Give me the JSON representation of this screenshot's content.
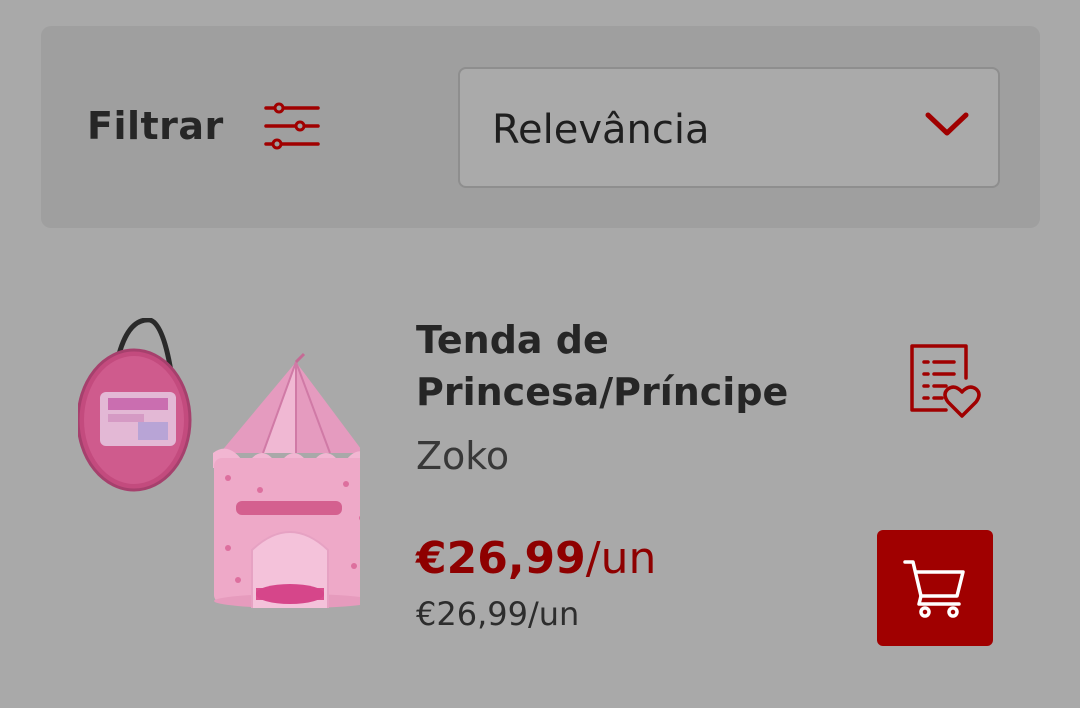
{
  "toolbar": {
    "filter_label": "Filtrar",
    "filter_icon": "sliders-icon",
    "sort": {
      "selected": "Relevância",
      "icon": "chevron-down-icon"
    }
  },
  "products": [
    {
      "title_line1": "Tenda de",
      "title_line2": "Princesa/Príncipe",
      "brand": "Zoko",
      "price_value": "€26,99",
      "price_unit": "/un",
      "price_secondary": "€26,99/un",
      "image_icon": "princess-tent-image",
      "wishlist_icon": "list-heart-icon",
      "cart_icon": "shopping-cart-icon"
    }
  ],
  "colors": {
    "accent": "#a00000",
    "price": "#8e0000",
    "background": "#a9a9a9",
    "panel": "#9f9f9f"
  }
}
